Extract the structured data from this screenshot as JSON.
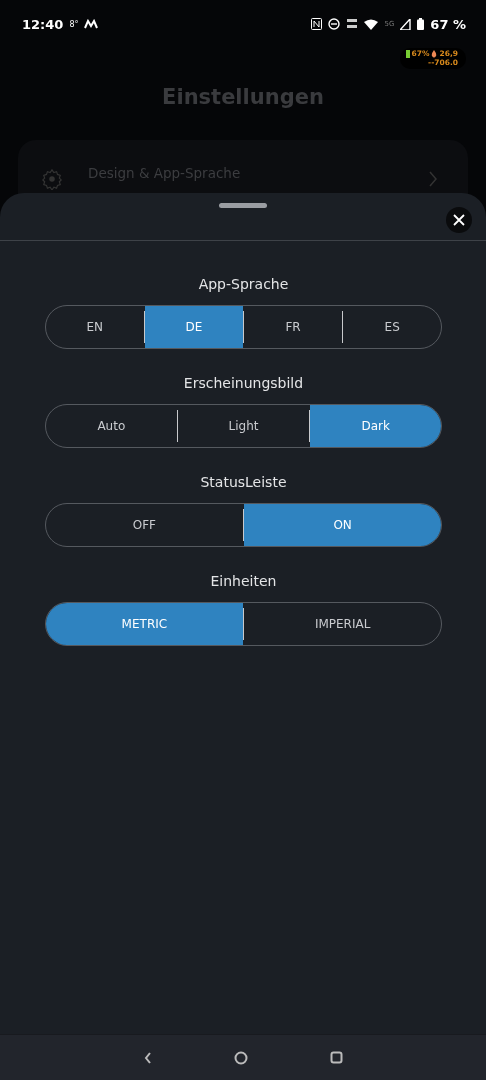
{
  "status_bar": {
    "time": "12:40",
    "temperature": "8°",
    "battery_percent": "67 %",
    "network": "5G"
  },
  "overlay_widget": {
    "battery": "67%",
    "temperature": "26,9",
    "current": "--706.0"
  },
  "background_page": {
    "title": "Einstellungen",
    "item": {
      "title": "Design & App-Sprache"
    }
  },
  "sheet": {
    "sections": [
      {
        "label": "App-Sprache",
        "options": [
          {
            "label": "EN",
            "selected": false
          },
          {
            "label": "DE",
            "selected": true
          },
          {
            "label": "FR",
            "selected": false
          },
          {
            "label": "ES",
            "selected": false
          }
        ]
      },
      {
        "label": "Erscheinungsbild",
        "options": [
          {
            "label": "Auto",
            "selected": false
          },
          {
            "label": "Light",
            "selected": false
          },
          {
            "label": "Dark",
            "selected": true
          }
        ]
      },
      {
        "label": "StatusLeiste",
        "options": [
          {
            "label": "OFF",
            "selected": false
          },
          {
            "label": "ON",
            "selected": true
          }
        ]
      },
      {
        "label": "Einheiten",
        "options": [
          {
            "label": "METRIC",
            "selected": true
          },
          {
            "label": "IMPERIAL",
            "selected": false
          }
        ]
      }
    ]
  }
}
